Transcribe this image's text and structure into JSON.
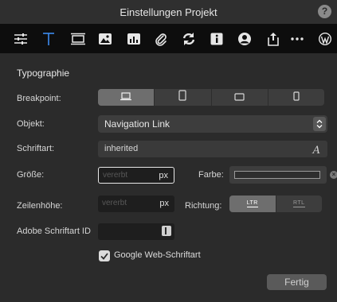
{
  "window": {
    "title": "Einstellungen Projekt",
    "help_label": "?"
  },
  "toolbar": {
    "icons": [
      "sliders-icon",
      "text-typography-icon",
      "layout-box-icon",
      "image-icon",
      "chart-icon",
      "paperclip-icon",
      "refresh-icon",
      "info-icon",
      "user-icon",
      "share-icon",
      "more-icon",
      "wordpress-icon"
    ],
    "active_index": 1,
    "accent_color": "#3d8cf0"
  },
  "section": {
    "title": "Typographie"
  },
  "breakpoint": {
    "label": "Breakpoint:",
    "options": [
      "desktop-icon",
      "tablet-portrait-icon",
      "tablet-landscape-icon",
      "phone-icon"
    ],
    "active_index": 0
  },
  "objekt": {
    "label": "Objekt:",
    "value": "Navigation Link"
  },
  "schriftart": {
    "label": "Schriftart:",
    "value": "inherited",
    "icon_glyph": "A"
  },
  "groesse": {
    "label": "Größe:",
    "placeholder": "vererbt",
    "unit": "px"
  },
  "farbe": {
    "label": "Farbe:",
    "clear_glyph": "×"
  },
  "zeilenhoehe": {
    "label": "Zeilenhöhe:",
    "placeholder": "vererbt",
    "unit": "px"
  },
  "richtung": {
    "label": "Richtung:",
    "options": [
      "LTR",
      "RTL"
    ],
    "active_index": 0
  },
  "adobe": {
    "label": "Adobe Schriftart ID"
  },
  "google": {
    "label": "Google Web-Schriftart",
    "checked": true
  },
  "footer": {
    "done_label": "Fertig"
  }
}
